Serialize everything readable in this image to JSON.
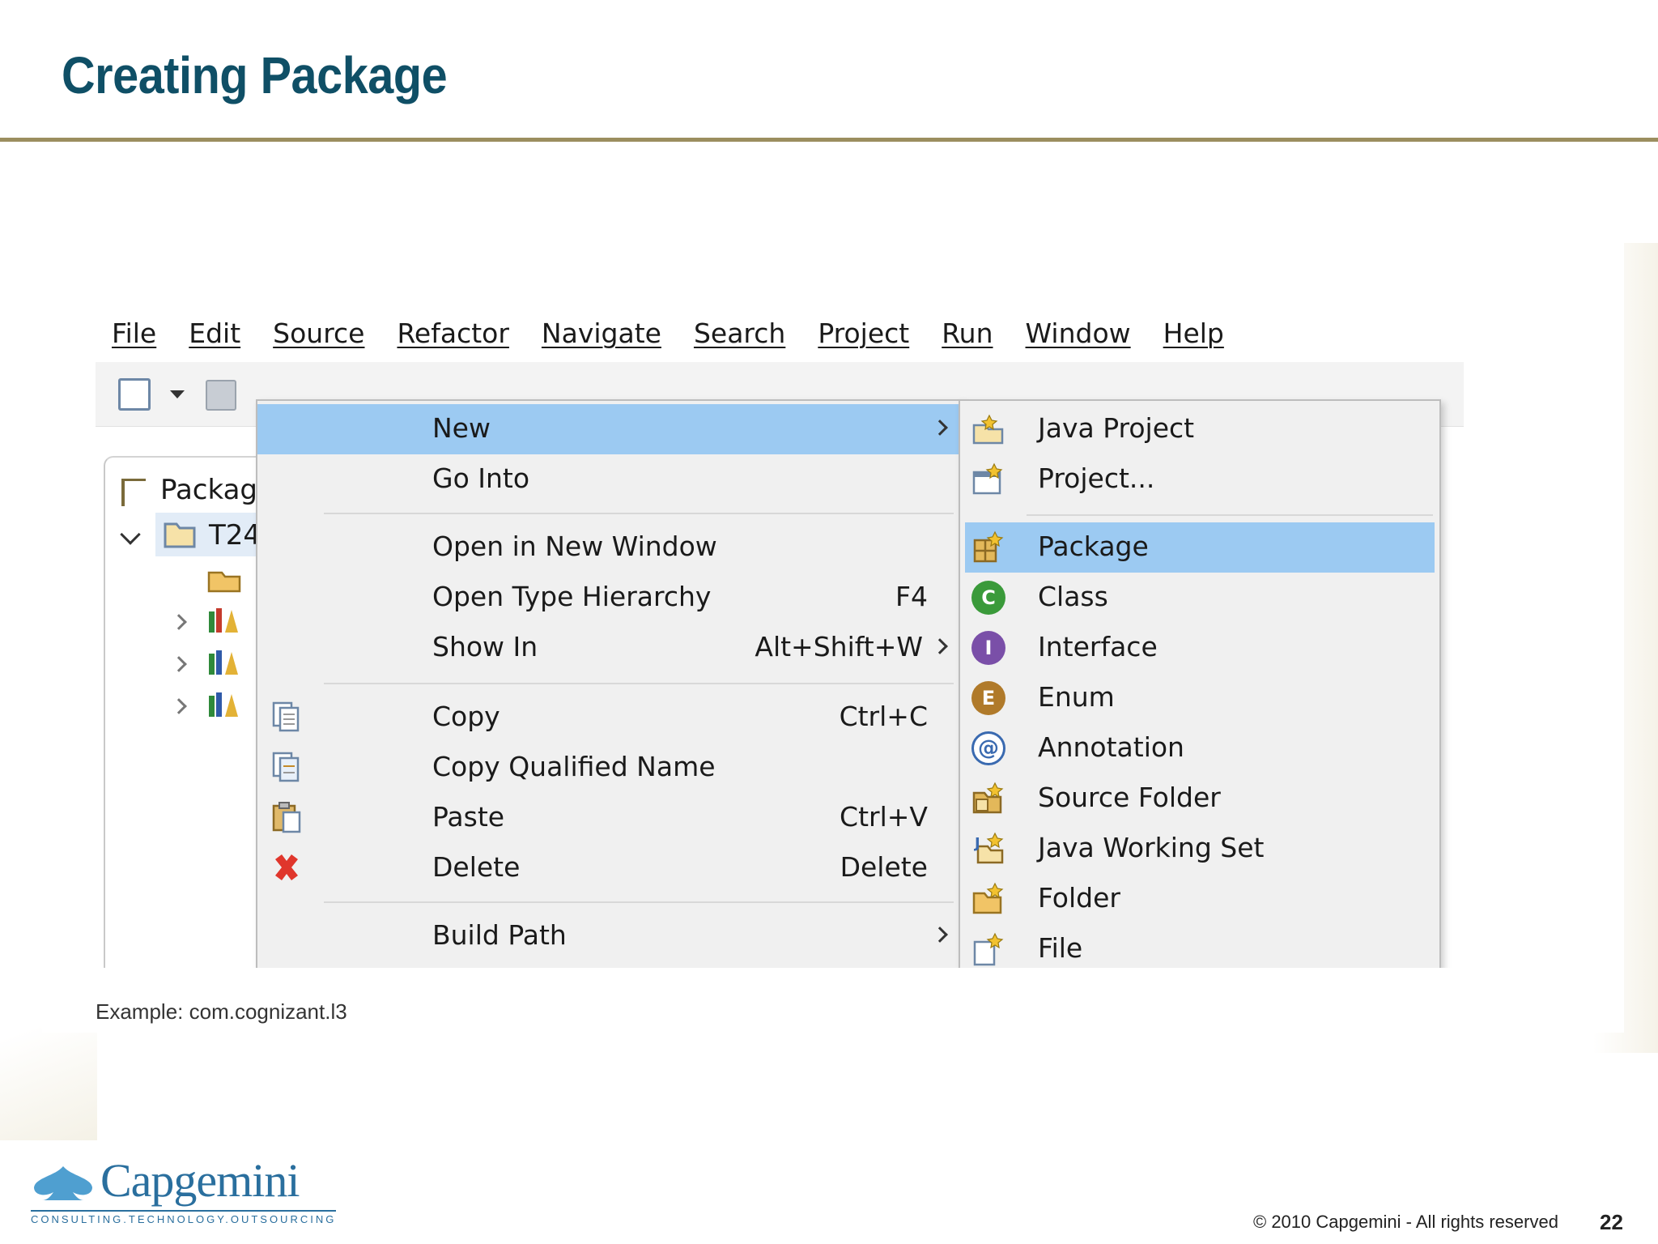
{
  "slide": {
    "title": "Creating Package",
    "caption": "Example: com.cognizant.l3",
    "copyright": "© 2010 Capgemini - All rights reserved",
    "page_number": "22",
    "logo": {
      "name": "Capgemini",
      "tagline": "CONSULTING.TECHNOLOGY.OUTSOURCING"
    }
  },
  "colors": {
    "title": "#0f4f66",
    "rule": "#9b8e5f",
    "highlight": "#9ccaf2",
    "brand": "#2a6f9e"
  },
  "menubar": [
    "File",
    "Edit",
    "Source",
    "Refactor",
    "Navigate",
    "Search",
    "Project",
    "Run",
    "Window",
    "Help"
  ],
  "package_explorer": {
    "title": "Packag",
    "project": "T24"
  },
  "context_menu": [
    {
      "label": "New",
      "accel": "",
      "submenu": true,
      "highlighted": true,
      "icon": "none"
    },
    {
      "label": "Go Into",
      "accel": "",
      "submenu": false,
      "icon": "none"
    },
    {
      "label": "Open in New Window",
      "accel": "",
      "submenu": false,
      "icon": "none"
    },
    {
      "label": "Open Type Hierarchy",
      "accel": "F4",
      "submenu": false,
      "icon": "none"
    },
    {
      "label": "Show In",
      "accel": "Alt+Shift+W",
      "submenu": true,
      "icon": "none"
    },
    {
      "label": "Copy",
      "accel": "Ctrl+C",
      "submenu": false,
      "icon": "copy-icon"
    },
    {
      "label": "Copy Qualified Name",
      "accel": "",
      "submenu": false,
      "icon": "copy-qualified-icon"
    },
    {
      "label": "Paste",
      "accel": "Ctrl+V",
      "submenu": false,
      "icon": "paste-icon"
    },
    {
      "label": "Delete",
      "accel": "Delete",
      "submenu": false,
      "icon": "delete-icon"
    },
    {
      "label": "Build Path",
      "accel": "",
      "submenu": true,
      "icon": "none"
    }
  ],
  "new_submenu": [
    {
      "label": "Java Project",
      "icon": "java-project-icon"
    },
    {
      "label": "Project...",
      "icon": "project-icon"
    },
    {
      "label": "Package",
      "icon": "package-icon",
      "highlighted": true
    },
    {
      "label": "Class",
      "icon": "class-icon"
    },
    {
      "label": "Interface",
      "icon": "interface-icon"
    },
    {
      "label": "Enum",
      "icon": "enum-icon"
    },
    {
      "label": "Annotation",
      "icon": "annotation-icon"
    },
    {
      "label": "Source Folder",
      "icon": "source-folder-icon"
    },
    {
      "label": "Java Working Set",
      "icon": "java-working-set-icon"
    },
    {
      "label": "Folder",
      "icon": "folder-icon"
    },
    {
      "label": "File",
      "icon": "file-icon"
    }
  ]
}
